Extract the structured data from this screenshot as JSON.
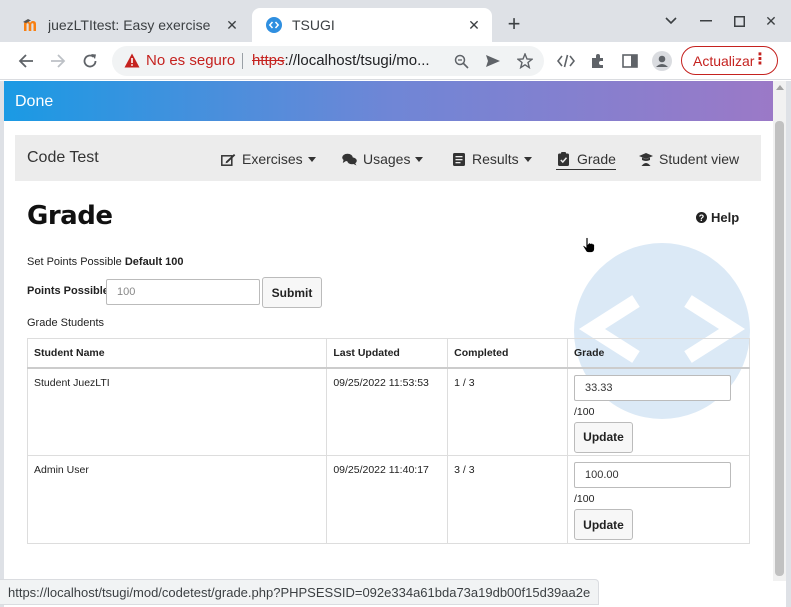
{
  "browser": {
    "tabs": [
      {
        "title": "juezLTItest: Easy exercise",
        "icon": "moodle-icon",
        "active": false
      },
      {
        "title": "TSUGI",
        "icon": "tsugi-icon",
        "active": true
      }
    ],
    "new_tab_label": "+",
    "address": {
      "security_label": "No es seguro",
      "scheme": "https",
      "rest": "://localhost/tsugi/mo..."
    },
    "update_label": "Actualizar",
    "status_url": "https://localhost/tsugi/mod/codetest/grade.php?PHPSESSID=092e334a61bda73a19db00f15d39aa2e"
  },
  "page": {
    "done_label": "Done",
    "brand": "Code Test",
    "nav": [
      {
        "label": "Exercises",
        "icon": "edit-icon",
        "dropdown": true
      },
      {
        "label": "Usages",
        "icon": "comments-icon",
        "dropdown": true
      },
      {
        "label": "Results",
        "icon": "list-icon",
        "dropdown": true
      },
      {
        "label": "Grade",
        "icon": "clipboard-check-icon",
        "dropdown": false
      },
      {
        "label": "Student view",
        "icon": "student-icon",
        "dropdown": false
      }
    ],
    "title": "Grade",
    "help_label": "Help",
    "set_points_text": "Set Points Possible",
    "set_points_default": "Default 100",
    "points_label": "Points Possible:",
    "points_placeholder": "100",
    "submit_label": "Submit",
    "grade_students_label": "Grade Students",
    "table": {
      "headers": [
        "Student Name",
        "Last Updated",
        "Completed",
        "Grade"
      ],
      "rows": [
        {
          "name": "Student JuezLTI",
          "updated": "09/25/2022 11:53:53",
          "completed": "1 / 3",
          "grade": "33.33",
          "max": "/100",
          "button": "Update"
        },
        {
          "name": "Admin User",
          "updated": "09/25/2022 11:40:17",
          "completed": "3 / 3",
          "grade": "100.00",
          "max": "/100",
          "button": "Update"
        }
      ]
    }
  },
  "colors": {
    "accent_red": "#c5221f",
    "done_gradient_start": "#1a9ae4",
    "done_gradient_end": "#9b79c7"
  }
}
